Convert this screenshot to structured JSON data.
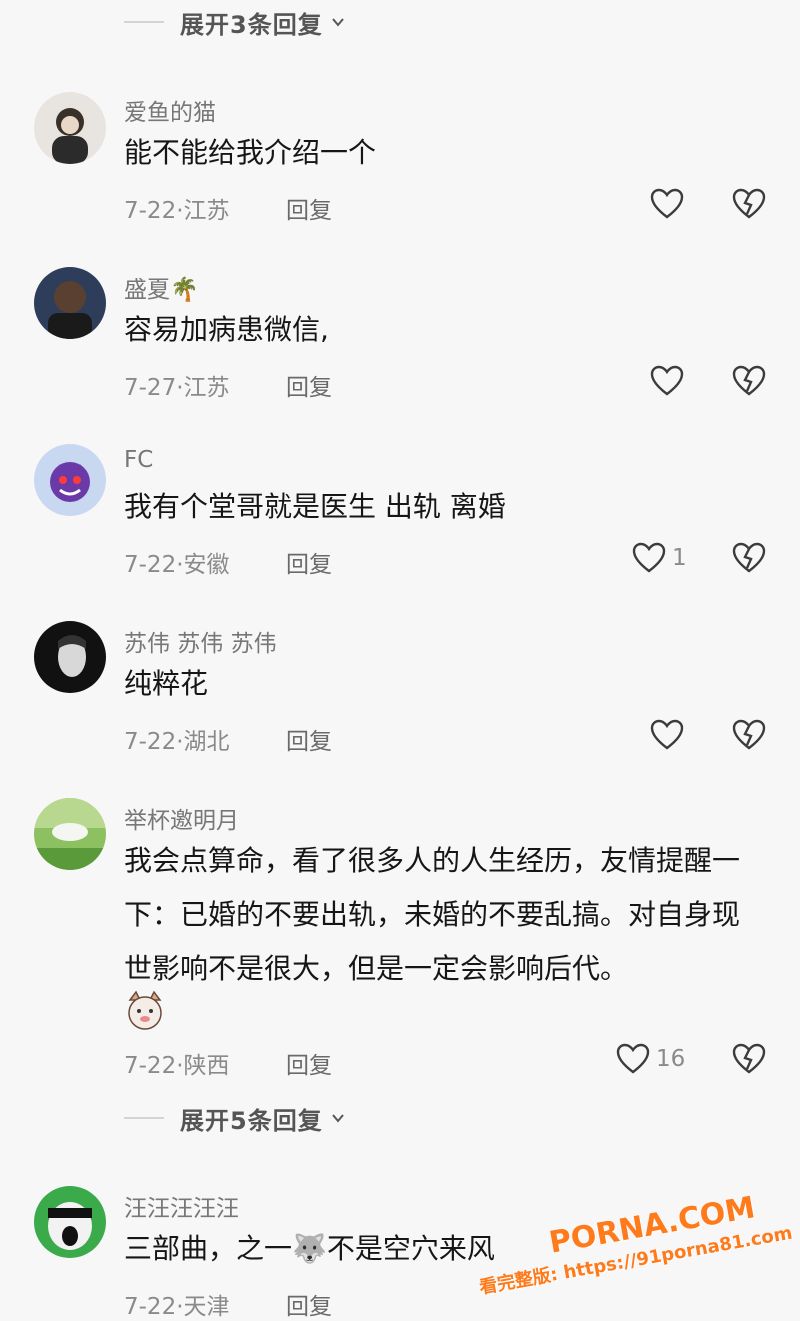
{
  "expand_top": {
    "label": "展开3条回复"
  },
  "expand_mid": {
    "label": "展开5条回复"
  },
  "comments": [
    {
      "user": "爱鱼的猫",
      "text": "能不能给我介绍一个",
      "meta": "7-22·江苏",
      "reply": "回复",
      "likes": ""
    },
    {
      "user": "盛夏🌴",
      "text": "容易加病患微信,",
      "meta": "7-27·江苏",
      "reply": "回复",
      "likes": ""
    },
    {
      "user": "FC",
      "text": "我有个堂哥就是医生   出轨    离婚",
      "meta": "7-22·安徽",
      "reply": "回复",
      "likes": "1"
    },
    {
      "user": "苏伟  苏伟  苏伟",
      "text": "纯粹花",
      "meta": "7-22·湖北",
      "reply": "回复",
      "likes": ""
    },
    {
      "user": "举杯邀明月",
      "text": "我会点算命，看了很多人的人生经历，友情提醒一下：已婚的不要出轨，未婚的不要乱搞。对自身现世影响不是很大，但是一定会影响后代。",
      "meta": "7-22·陕西",
      "reply": "回复",
      "likes": "16"
    },
    {
      "user": "汪汪汪汪汪",
      "text": "三部曲，之一🐺不是空穴来风",
      "meta": "7-22·天津",
      "reply": "回复",
      "likes": ""
    }
  ],
  "watermark": {
    "main": "PORNA.COM",
    "sub": "看完整版: https://91porna81.com"
  },
  "colors": {
    "background": "#f7f7f7",
    "text": "#161616",
    "secondary": "#8a8a8a",
    "watermark": "#ff7a1a"
  }
}
